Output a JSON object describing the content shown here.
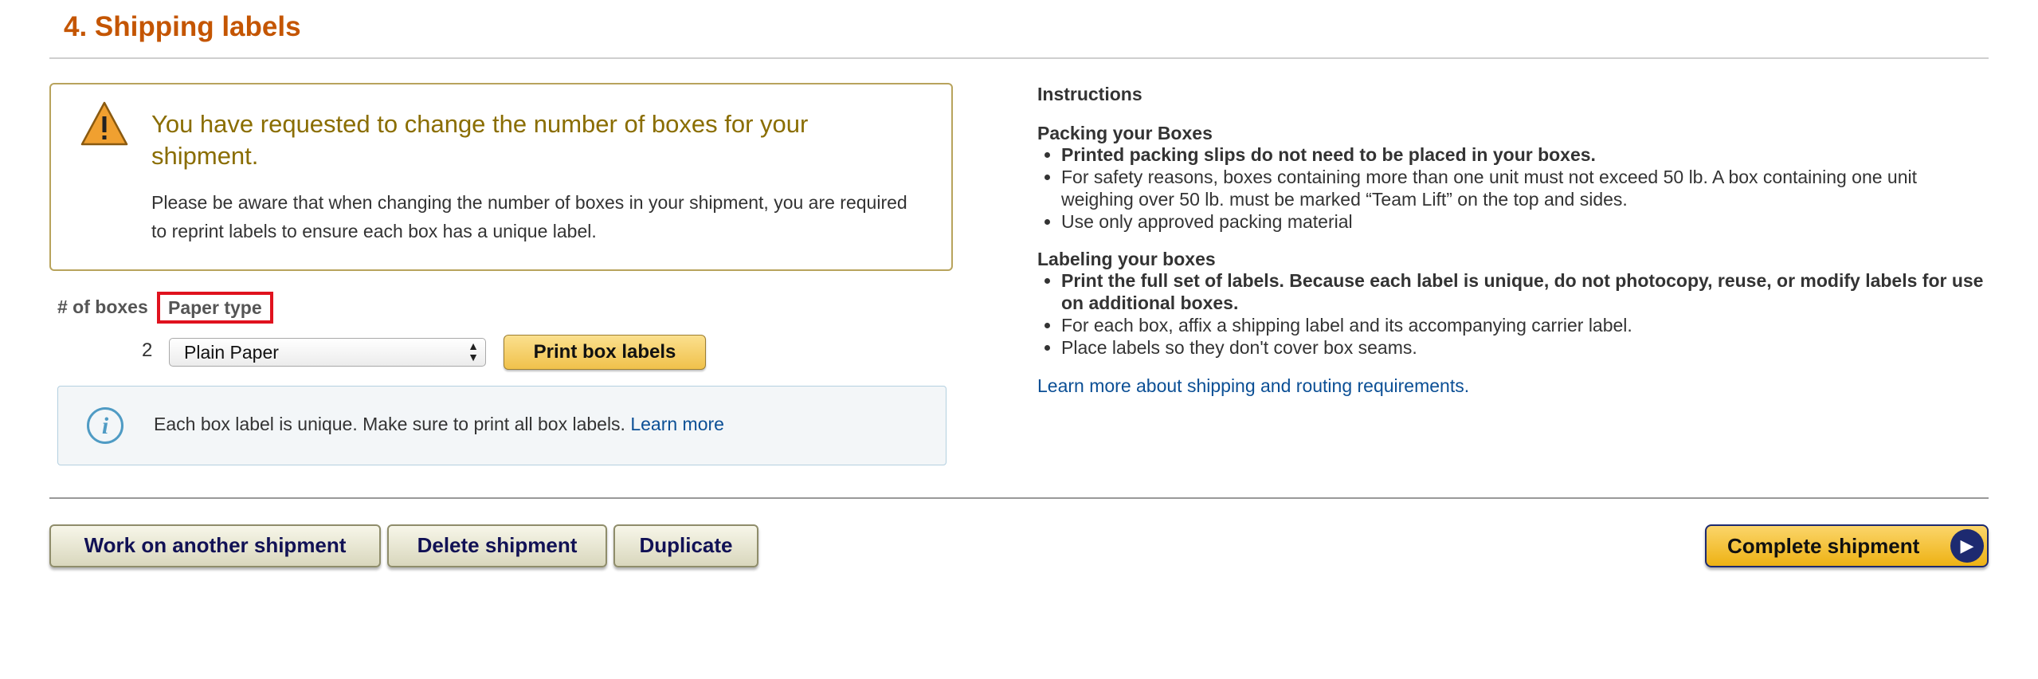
{
  "section": {
    "title": "4. Shipping labels"
  },
  "alert": {
    "heading": "You have requested to change the number of boxes for your shipment.",
    "body": "Please be aware that when changing the number of boxes in your shipment, you are required to reprint labels to ensure each box has a unique label."
  },
  "form": {
    "boxes_label": "# of boxes",
    "paper_label": "Paper type",
    "box_count": "2",
    "paper_selected": "Plain Paper",
    "print_button": "Print box labels"
  },
  "info": {
    "text": "Each box label is unique. Make sure to print all box labels.",
    "link": "Learn more"
  },
  "instructions": {
    "title": "Instructions",
    "packing_heading": "Packing your Boxes",
    "packing_items": [
      "Printed packing slips do not need to be placed in your boxes.",
      "For safety reasons, boxes containing more than one unit must not exceed 50 lb. A box containing one unit weighing over 50 lb. must be marked “Team Lift” on the top and sides.",
      "Use only approved packing material"
    ],
    "labeling_heading": "Labeling your boxes",
    "labeling_items": [
      "Print the full set of labels. Because each label is unique, do not photocopy, reuse, or modify labels for use on additional boxes.",
      "For each box, affix a shipping label and its accompanying carrier label.",
      "Place labels so they don't cover box seams."
    ],
    "learn_link": "Learn more about shipping and routing requirements."
  },
  "buttons": {
    "work_another": "Work on another shipment",
    "delete": "Delete shipment",
    "duplicate": "Duplicate",
    "complete": "Complete shipment"
  },
  "icons": {
    "warning": "warning-icon",
    "info": "info-icon",
    "select_arrows": "select-arrows-icon",
    "arrow_right": "arrow-right-icon"
  },
  "colors": {
    "title": "#c45500",
    "link": "#0b4f95",
    "highlight_box": "#e0121e",
    "primary_button": "#f0c14b"
  }
}
